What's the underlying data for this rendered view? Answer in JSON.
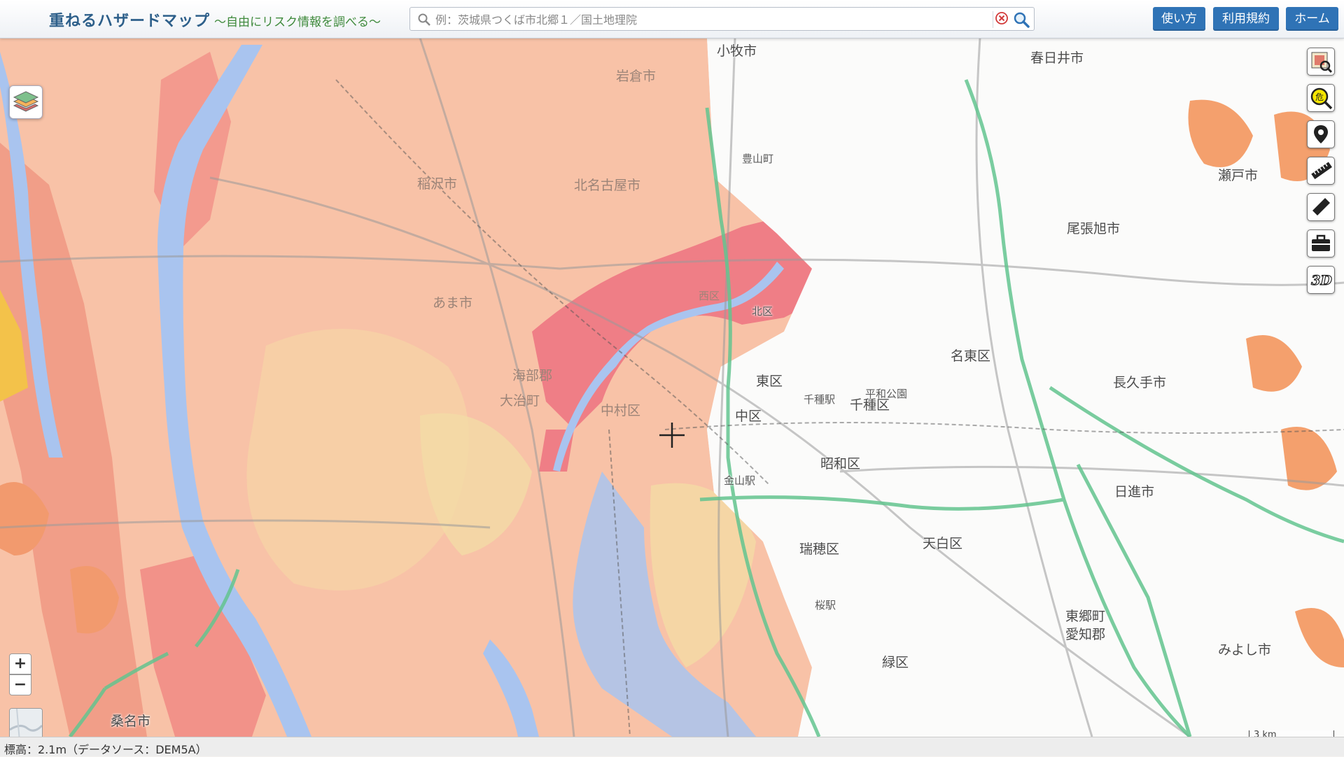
{
  "header": {
    "title": "重ねるハザードマップ",
    "subtitle": "～自由にリスク情報を調べる～",
    "search_placeholder": "例：茨城県つくば市北郷１／国土地理院",
    "buttons": {
      "howto": "使い方",
      "terms": "利用規約",
      "home": "ホーム"
    }
  },
  "map": {
    "labels": [
      "小牧市",
      "春日井市",
      "岩倉市",
      "北名古屋市",
      "稲沢市",
      "あま市",
      "海部郡",
      "大治町",
      "中村区",
      "中区",
      "東区",
      "千種区",
      "名東区",
      "昭和区",
      "瑞穂区",
      "天白区",
      "緑区",
      "尾張旭市",
      "瀬戸市",
      "長久手市",
      "日進市",
      "東郷町",
      "愛知郡",
      "みよし市",
      "桑名市",
      "西区",
      "北区",
      "千種駅",
      "平和公園",
      "金山駅",
      "桜駅",
      "大治町",
      "豊山町"
    ],
    "scale": "3 km",
    "icons": [
      "layers-icon",
      "map-index-icon",
      "hazard-search-icon",
      "pin-icon",
      "ruler-icon",
      "pencil-icon",
      "toolbox-icon",
      "3d-icon"
    ]
  },
  "controls": {
    "zoom_in": "+",
    "zoom_out": "−",
    "three_d": "3D"
  },
  "footer": {
    "elevation_text": "標高：2.1m（データソース：DEM5A）"
  },
  "colors": {
    "header_button": "#2f73b6",
    "flood_light": "#f7c0a4",
    "flood_mid": "#f3a08c",
    "flood_deep": "#ee7f82",
    "river": "#a9c4ef",
    "highway": "#63c48f"
  }
}
